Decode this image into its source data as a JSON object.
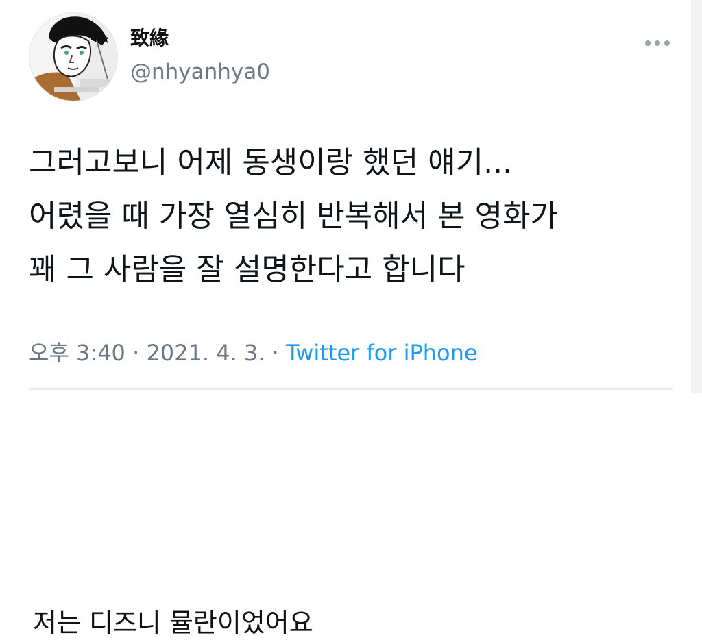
{
  "tweet": {
    "display_name": "致緣",
    "handle": "@nhyanhya0",
    "text_lines": [
      "그러고보니 어제 동생이랑 했던 얘기...",
      "어렸을 때 가장 열심히 반복해서 본 영화가",
      "꽤 그 사람을 잘 설명한다고 합니다"
    ],
    "meta": {
      "time": "오후 3:40",
      "separator": "·",
      "date": "2021. 4. 3.",
      "source": "Twitter for iPhone"
    },
    "more_icon": "more-horizontal-icon",
    "avatar_icon": "avatar-icon"
  },
  "caption": "저는 디즈니 뮬란이었어요",
  "colors": {
    "background": "#ffffff",
    "text_primary": "#0f1419",
    "text_secondary": "#6b7785",
    "link": "#1d9bf0",
    "divider": "#ececec"
  }
}
